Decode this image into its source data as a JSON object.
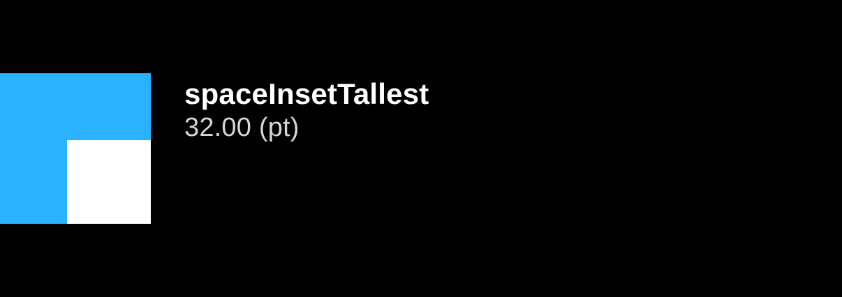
{
  "token": {
    "name": "spaceInsetTallest",
    "value": "32.00 (pt)"
  },
  "colors": {
    "background": "#000000",
    "swatch_fill": "#2AB2FF",
    "swatch_inset": "#FFFFFF",
    "name_text": "#FFFFFF",
    "value_text": "#D6D6D6"
  }
}
